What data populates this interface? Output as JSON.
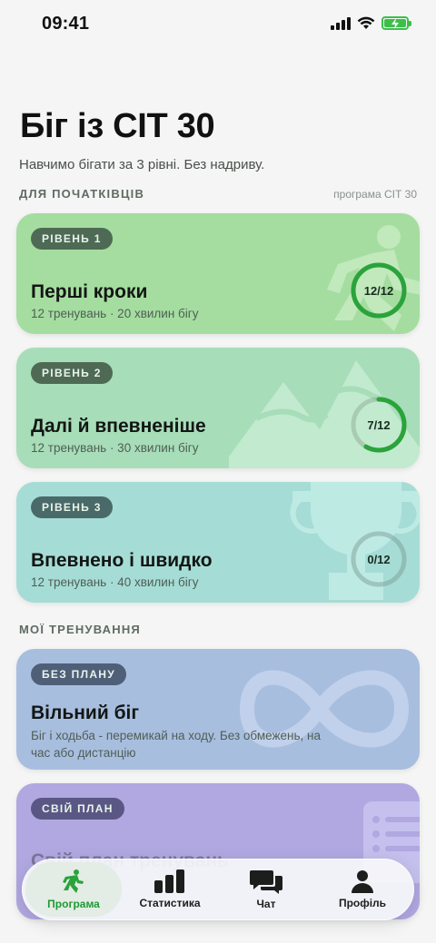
{
  "status_bar": {
    "time": "09:41"
  },
  "header": {
    "title": "Біг із СІТ 30",
    "subtitle": "Навчимо бігати за 3 рівні. Без надриву."
  },
  "sections": {
    "beginners": {
      "label": "ДЛЯ ПОЧАТКІВЦІВ",
      "aside": "програма СІТ 30"
    },
    "my_workouts": {
      "label": "МОЇ ТРЕНУВАННЯ"
    }
  },
  "levels": [
    {
      "badge": "РІВЕНЬ 1",
      "title": "Перші кроки",
      "subtitle": "12 тренувань · 20 хвилин бігу",
      "progress_text": "12/12",
      "done": 12,
      "total": 12,
      "icon": "running-person-icon"
    },
    {
      "badge": "РІВЕНЬ 2",
      "title": "Далі й впевненіше",
      "subtitle": "12 тренувань · 30 хвилин бігу",
      "progress_text": "7/12",
      "done": 7,
      "total": 12,
      "icon": "mountains-icon"
    },
    {
      "badge": "РІВЕНЬ 3",
      "title": "Впевнено і швидко",
      "subtitle": "12 тренувань · 40 хвилин бігу",
      "progress_text": "0/12",
      "done": 0,
      "total": 12,
      "icon": "trophy-icon"
    }
  ],
  "free_run": {
    "badge": "БЕЗ ПЛАНУ",
    "title": "Вільний біг",
    "subtitle": "Біг і ходьба - перемикай на ходу. Без обмежень, на час або дистанцію",
    "icon": "infinity-icon"
  },
  "own_plan": {
    "badge": "СВІЙ ПЛАН",
    "title": "Свій план тренувань",
    "icon": "list-icon"
  },
  "tabs": [
    {
      "label": "Програма",
      "icon": "running-icon",
      "active": true
    },
    {
      "label": "Статистика",
      "icon": "bar-chart-icon",
      "active": false
    },
    {
      "label": "Чат",
      "icon": "chat-icon",
      "active": false
    },
    {
      "label": "Профіль",
      "icon": "person-icon",
      "active": false
    }
  ],
  "colors": {
    "accent": "#2aa33b",
    "level1_bg": "#a5dda0",
    "level2_bg": "#a7ddb8",
    "level3_bg": "#a6dcd6",
    "free_bg": "#a8bedf",
    "own_bg": "#b1a8e1"
  }
}
